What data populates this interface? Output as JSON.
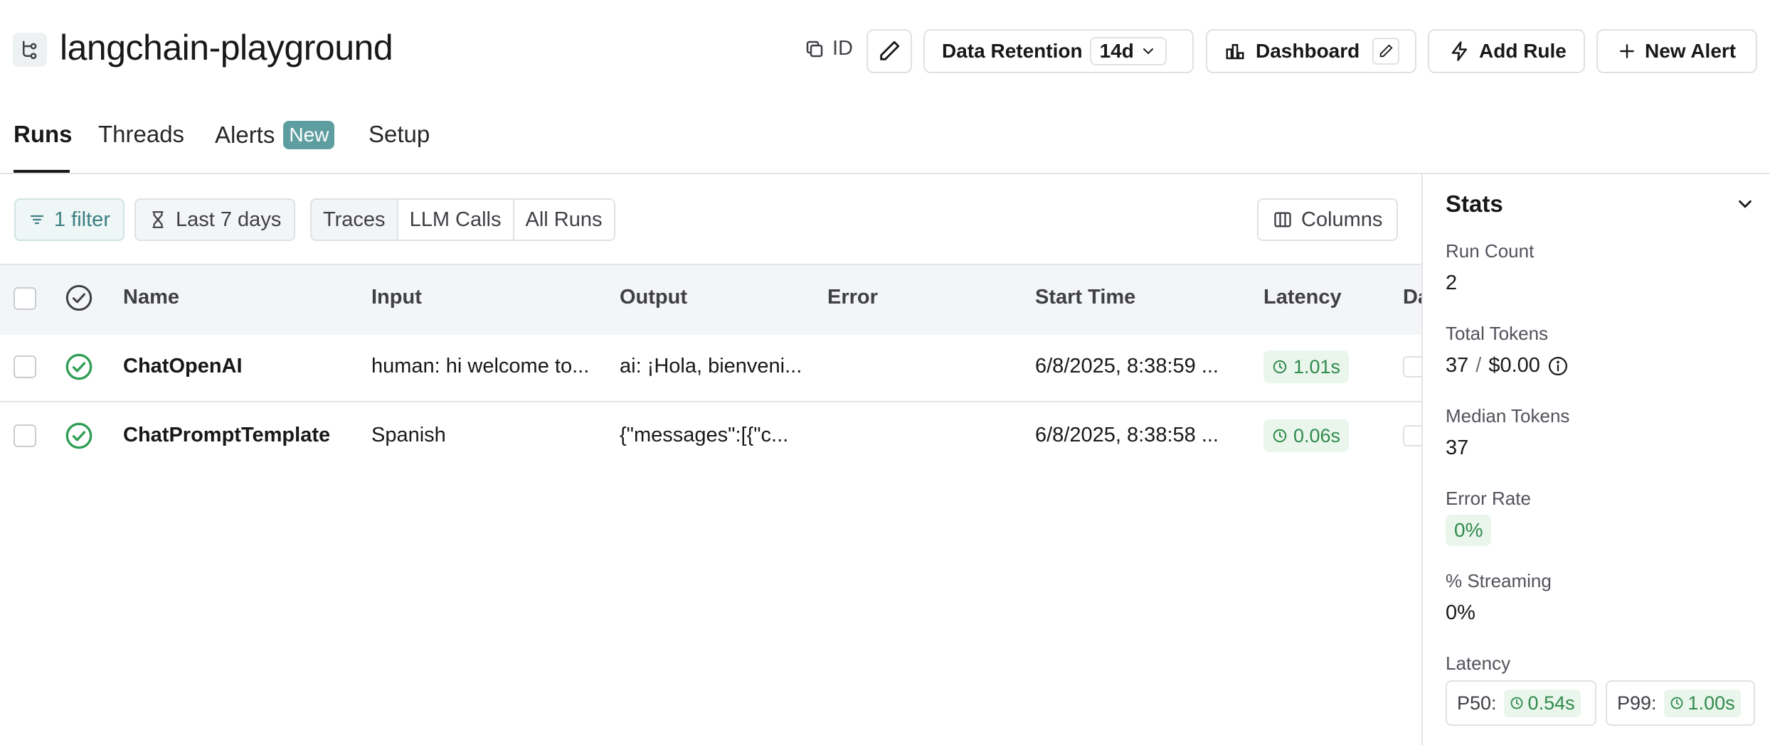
{
  "header": {
    "project_name": "langchain-playground",
    "id_label": "ID",
    "data_retention_label": "Data Retention",
    "data_retention_value": "14d",
    "dashboard_label": "Dashboard",
    "add_rule_label": "Add Rule",
    "new_alert_label": "New Alert"
  },
  "tabs": [
    {
      "label": "Runs",
      "active": true
    },
    {
      "label": "Threads"
    },
    {
      "label": "Alerts",
      "badge": "New"
    },
    {
      "label": "Setup"
    }
  ],
  "toolbar": {
    "filter_label": "1 filter",
    "time_range_label": "Last 7 days",
    "view_options": [
      "Traces",
      "LLM Calls",
      "All Runs"
    ],
    "view_selected": "Traces",
    "columns_label": "Columns"
  },
  "table": {
    "columns": [
      "Name",
      "Input",
      "Output",
      "Error",
      "Start Time",
      "Latency",
      "Da"
    ],
    "rows": [
      {
        "name": "ChatOpenAI",
        "input": "human: hi welcome to...",
        "output": "ai: ¡Hola, bienveni...",
        "error": "",
        "start_time": "6/8/2025, 8:38:59 ...",
        "latency": "1.01s",
        "status": "success"
      },
      {
        "name": "ChatPromptTemplate",
        "input": "Spanish",
        "output": "{\"messages\":[{\"c...",
        "error": "",
        "start_time": "6/8/2025, 8:38:58 ...",
        "latency": "0.06s",
        "status": "success"
      }
    ]
  },
  "stats": {
    "title": "Stats",
    "run_count_label": "Run Count",
    "run_count": "2",
    "total_tokens_label": "Total Tokens",
    "total_tokens": "37",
    "total_cost": "$0.00",
    "median_tokens_label": "Median Tokens",
    "median_tokens": "37",
    "error_rate_label": "Error Rate",
    "error_rate": "0%",
    "streaming_label": "% Streaming",
    "streaming": "0%",
    "latency_label": "Latency",
    "p50_label": "P50:",
    "p50": "0.54s",
    "p99_label": "P99:",
    "p99": "1.00s"
  },
  "colors": {
    "accent_teal": "#5f9ea0",
    "success_green": "#2f8a4c",
    "success_bg": "#eaf6ec",
    "header_row_bg": "#f4f5f6"
  }
}
